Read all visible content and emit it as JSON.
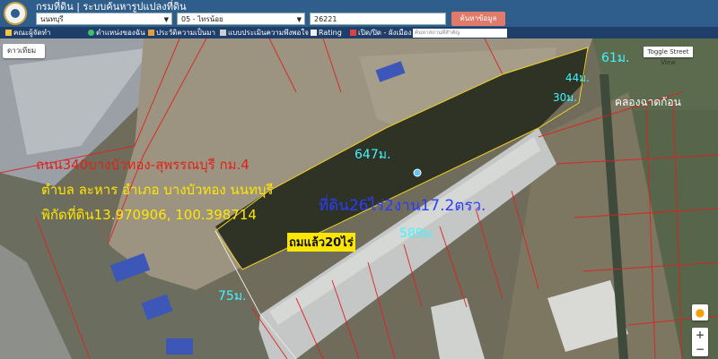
{
  "header": {
    "title": "กรมที่ดิน | ระบบค้นหารูปแปลงที่ดิน",
    "province": "นนทบุรี",
    "district": "05 - ไทรน้อย",
    "parcel_no": "26221",
    "search_button": "ค้นหาข้อมูล"
  },
  "toolbar": {
    "items": [
      {
        "label": "คณะผู้จัดทำ"
      },
      {
        "label": "ตำแหน่งของฉัน"
      },
      {
        "label": "ประวัติความเป็นมา"
      },
      {
        "label": "แบบประเมินความพึงพอใจ"
      },
      {
        "label": "Rating"
      },
      {
        "label": "เปิด/ปิด - ผังเมือง"
      }
    ],
    "search_placeholder": "ค้นหาสถานที่สำคัญ"
  },
  "map": {
    "map_type": "ดาวเทียม",
    "street_view": "Toggle Street View",
    "zoom_in": "+",
    "zoom_out": "−",
    "annotations": {
      "road": "ถนน340บางบัวทอง-สุพรรณบุรี กม.4",
      "location": "ตำบล ละหาร อำเภอ บางบัวทอง นนทบุรี",
      "coords": "พิกัดที่ดิน13.970906, 100.398714",
      "area": "ที่ดิน26ไร่2งาน17.2ตรว.",
      "filled": "ถมแล้ว20ไร่",
      "canal": "คลองฉาดก้อน",
      "dim_north": "647ม.",
      "dim_south": "589ม.",
      "dim_west": "75ม.",
      "dim_ne": "61ม.",
      "dim_44": "44ม.",
      "dim_30": "30ม."
    }
  },
  "colors": {
    "header_bg": "#2f5d8c",
    "toolbar_bg": "#1f3f6a",
    "annotation_red": "#e0211b",
    "annotation_yellow": "#ffe600",
    "annotation_cyan": "#3ff5ff",
    "annotation_blue": "#2a3cff",
    "parcel_outline": "#e02020",
    "target_outline": "#f0d020"
  }
}
